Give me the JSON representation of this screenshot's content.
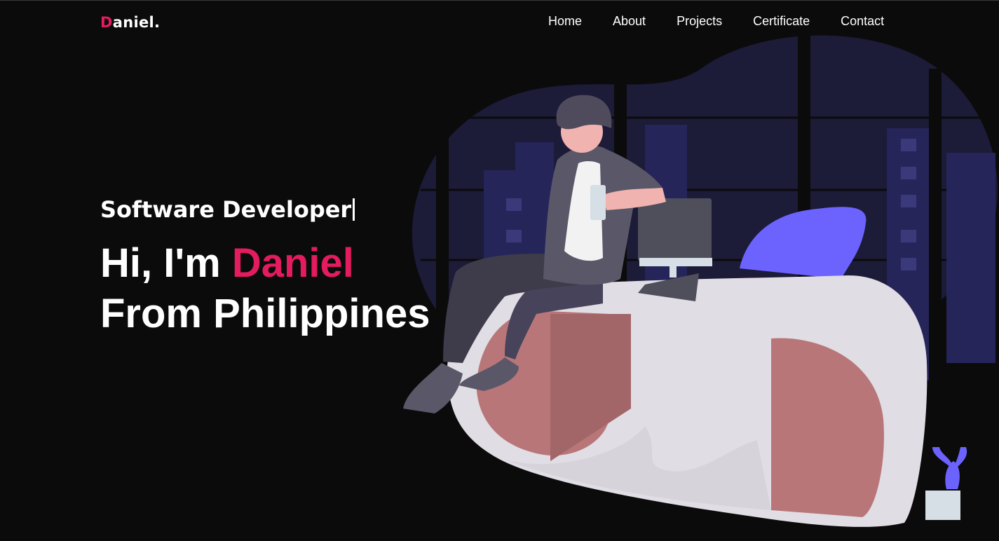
{
  "brand": {
    "first_letter": "D",
    "rest": "aniel."
  },
  "nav": {
    "items": [
      "Home",
      "About",
      "Projects",
      "Certificate",
      "Contact"
    ]
  },
  "hero": {
    "role": "Software Developer",
    "greeting": "Hi, I'm ",
    "name": "Daniel",
    "location": "From Philippines"
  },
  "colors": {
    "accent": "#e31b5f",
    "background": "#0b0b0b",
    "illustration_blob": "#1c1b38",
    "chair": "#6c63ff",
    "desk": "#e0dde4",
    "desk_panel": "#b87678"
  },
  "icons": [
    "developer-at-desk-illustration",
    "cactus-plant-icon",
    "monitor-icon",
    "chair-icon"
  ]
}
